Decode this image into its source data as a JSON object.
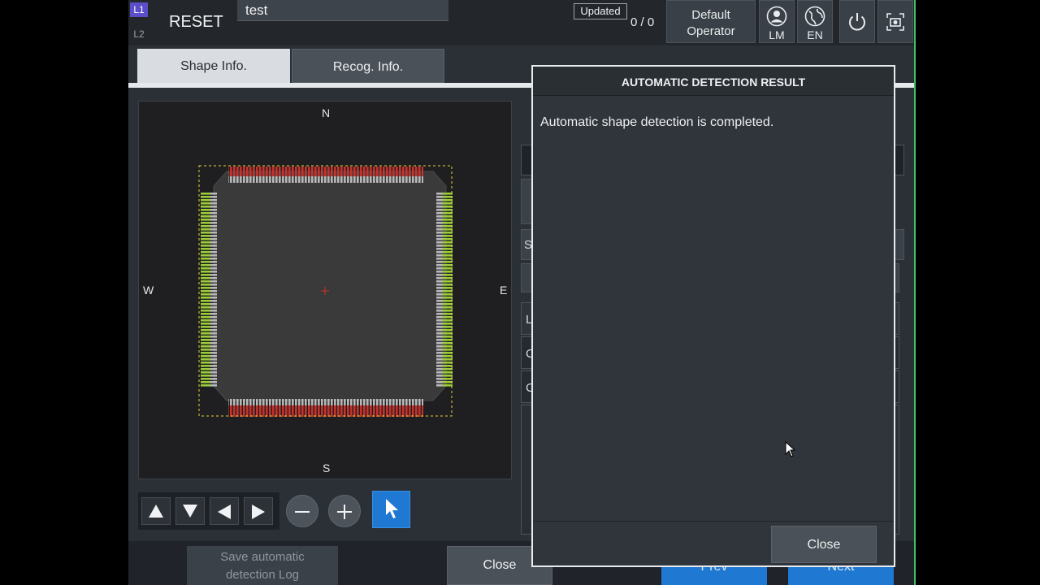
{
  "header": {
    "level_1": "L1",
    "level_2": "L2",
    "mode_title": "RESET",
    "job_name": "test",
    "status_badge": "Updated",
    "counter": "0 / 0",
    "operator_line1": "Default",
    "operator_line2": "Operator",
    "user_button_label": "LM",
    "language_button_label": "EN",
    "icons": [
      "user-icon",
      "globe-icon",
      "power-icon",
      "camera-icon"
    ]
  },
  "tabs": [
    {
      "label": "Shape Info.",
      "active": true
    },
    {
      "label": "Recog. Info.",
      "active": false
    }
  ],
  "viewer": {
    "compass": {
      "north": "N",
      "south": "S",
      "west": "W",
      "east": "E"
    }
  },
  "navigation": {
    "icons": [
      "arrow-up-icon",
      "arrow-down-icon",
      "arrow-left-icon",
      "arrow-right-icon",
      "zoom-out-icon",
      "zoom-in-icon",
      "pointer-icon"
    ]
  },
  "footer": {
    "save_log_line1": "Save automatic",
    "save_log_line2": "detection Log",
    "close_label": "Close",
    "prev_label": "Prev",
    "next_label": "Next"
  },
  "right_panel": {
    "partial_letters": [
      "S",
      "L",
      "C",
      "C"
    ]
  },
  "dialog": {
    "title": "AUTOMATIC DETECTION RESULT",
    "message": "Automatic shape detection is completed.",
    "close_label": "Close"
  },
  "colors": {
    "accent_blue": "#1f78d1",
    "lead_red": "#c8322c",
    "lead_green": "#9ccc3a",
    "level_badge": "#5a4fc9"
  }
}
